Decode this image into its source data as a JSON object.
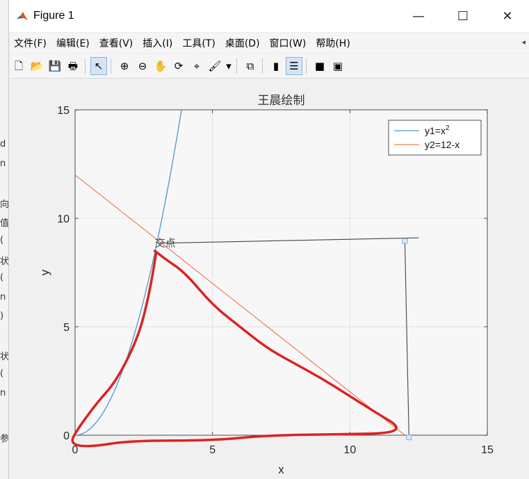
{
  "left_strip": {
    "glyphs": [
      "d",
      "n",
      "向",
      "值",
      "(",
      "状",
      "(",
      "n",
      ")",
      "状",
      "(",
      "n",
      "参"
    ]
  },
  "window": {
    "title": "Figure 1",
    "minimize": "—",
    "maximize": "☐",
    "close": "✕"
  },
  "menu": [
    "文件(F)",
    "编辑(E)",
    "查看(V)",
    "插入(I)",
    "工具(T)",
    "桌面(D)",
    "窗口(W)",
    "帮助(H)"
  ],
  "menu_overflow": "◂",
  "toolbar": {
    "icons": [
      "new-figure-icon",
      "open-file-icon",
      "save-icon",
      "print-icon",
      "pointer-icon",
      "zoom-in-icon",
      "zoom-out-icon",
      "pan-hand-icon",
      "rotate-3d-icon",
      "data-cursor-icon",
      "brush-icon",
      "brush-dropdown-icon",
      "link-plot-icon",
      "colorbar-icon",
      "legend-icon",
      "hide-plot-tools-icon",
      "show-plot-tools-icon"
    ],
    "glyphs": [
      "🗋",
      "📂",
      "💾",
      "🖶",
      "↖",
      "⊕",
      "⊖",
      "✋",
      "⟳",
      "⌖",
      "🖌",
      "▾",
      "⧉",
      "▮",
      "☰",
      "■",
      "▣"
    ]
  },
  "colors": {
    "series1": "#4f97c9",
    "series2": "#e8805a",
    "annotation": "#444444",
    "handles": "#7ab0e0",
    "markup": "#dd2222",
    "axes_bg": "#f7f7f7",
    "grid": "#e2e2e2"
  },
  "chart_data": {
    "type": "line",
    "title": "王晨绘制",
    "xlabel": "x",
    "ylabel": "y",
    "xlim": [
      0,
      15
    ],
    "ylim": [
      0,
      15
    ],
    "xticks": [
      0,
      5,
      10,
      15
    ],
    "yticks": [
      0,
      5,
      10,
      15
    ],
    "grid": true,
    "legend_position": "top-right",
    "series": [
      {
        "name": "y1=x2",
        "legend_base": "y1=x",
        "legend_sup": "2",
        "expr": "x^2",
        "x_range": [
          0,
          3.873
        ]
      },
      {
        "name": "y2=12-x",
        "legend_base": "y2=12-x",
        "expr": "12-x",
        "x_range": [
          0,
          12
        ]
      }
    ],
    "annotation": {
      "text": "交点",
      "arrow_from": [
        12.5,
        9.1
      ],
      "arrow_to": [
        3,
        8.85
      ],
      "leader_line": [
        [
          12,
          8.95
        ],
        [
          12.15,
          -0.1
        ]
      ],
      "handle_points": [
        [
          12,
          8.95
        ],
        [
          12.15,
          -0.1
        ]
      ],
      "label_at": [
        3,
        8.9
      ]
    },
    "freehand_markup": [
      [
        2.9,
        8.5
      ],
      [
        3.3,
        8.1
      ],
      [
        4.0,
        7.5
      ],
      [
        5.0,
        6.0
      ],
      [
        6.0,
        5.0
      ],
      [
        7.0,
        4.0
      ],
      [
        8.0,
        3.3
      ],
      [
        9.0,
        2.6
      ],
      [
        10.0,
        1.8
      ],
      [
        11.0,
        1.0
      ],
      [
        11.8,
        0.4
      ],
      [
        11.5,
        0.1
      ],
      [
        10.0,
        0.05
      ],
      [
        7.0,
        0.0
      ],
      [
        5.0,
        -0.25
      ],
      [
        2.0,
        -0.25
      ],
      [
        0.5,
        -0.55
      ],
      [
        -0.2,
        -0.4
      ],
      [
        0.1,
        0.3
      ],
      [
        0.8,
        1.5
      ],
      [
        1.5,
        2.5
      ],
      [
        2.3,
        4.5
      ],
      [
        2.7,
        6.5
      ],
      [
        2.95,
        8.4
      ]
    ]
  }
}
